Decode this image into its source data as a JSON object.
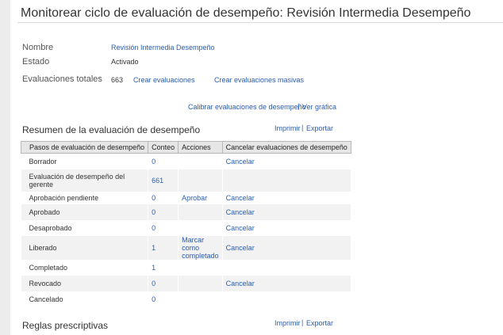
{
  "page": {
    "title": "Monitorear ciclo de evaluación de desempeño: Revisión Intermedia Desempeño"
  },
  "details": {
    "name_label": "Nombre",
    "name_value": "Revisión Intermedia Desempeño",
    "status_label": "Estado",
    "status_value": "Activado",
    "total_label": "Evaluaciones totales",
    "total_value": "663",
    "create_link": "Crear evaluaciones",
    "create_mass_link": "Crear evaluaciones masivas"
  },
  "calibration": {
    "calibrate_link": "Calibrar evaluaciones de desempeño",
    "separator": "|",
    "chart_link": "Ver gráfica"
  },
  "summary": {
    "title": "Resumen de la evaluación de desempeño",
    "print_link": "Imprimir",
    "separator": "|",
    "export_link": "Exportar",
    "columns": [
      "Pasos de evaluación de desempeño",
      "Conteo",
      "Acciones",
      "Cancelar evaluaciones de desempeño"
    ],
    "rows": [
      {
        "step": "Borrador",
        "count": "0",
        "action": "",
        "cancel": "Cancelar"
      },
      {
        "step": "Evaluación de desempeño del gerente",
        "count": "661",
        "action": "",
        "cancel": ""
      },
      {
        "step": "Aprobación pendiente",
        "count": "0",
        "action": "Aprobar",
        "cancel": "Cancelar"
      },
      {
        "step": "Aprobado",
        "count": "0",
        "action": "",
        "cancel": "Cancelar"
      },
      {
        "step": "Desaprobado",
        "count": "0",
        "action": "",
        "cancel": "Cancelar"
      },
      {
        "step": "Liberado",
        "count": "1",
        "action": "Marcar como completado",
        "cancel": "Cancelar"
      },
      {
        "step": "Completado",
        "count": "1",
        "action": "",
        "cancel": ""
      },
      {
        "step": "Revocado",
        "count": "0",
        "action": "",
        "cancel": "Cancelar"
      },
      {
        "step": "Cancelado",
        "count": "0",
        "action": "",
        "cancel": ""
      }
    ]
  },
  "rules": {
    "title": "Reglas prescriptivas",
    "print_link": "Imprimir",
    "separator": "|",
    "export_link": "Exportar"
  }
}
